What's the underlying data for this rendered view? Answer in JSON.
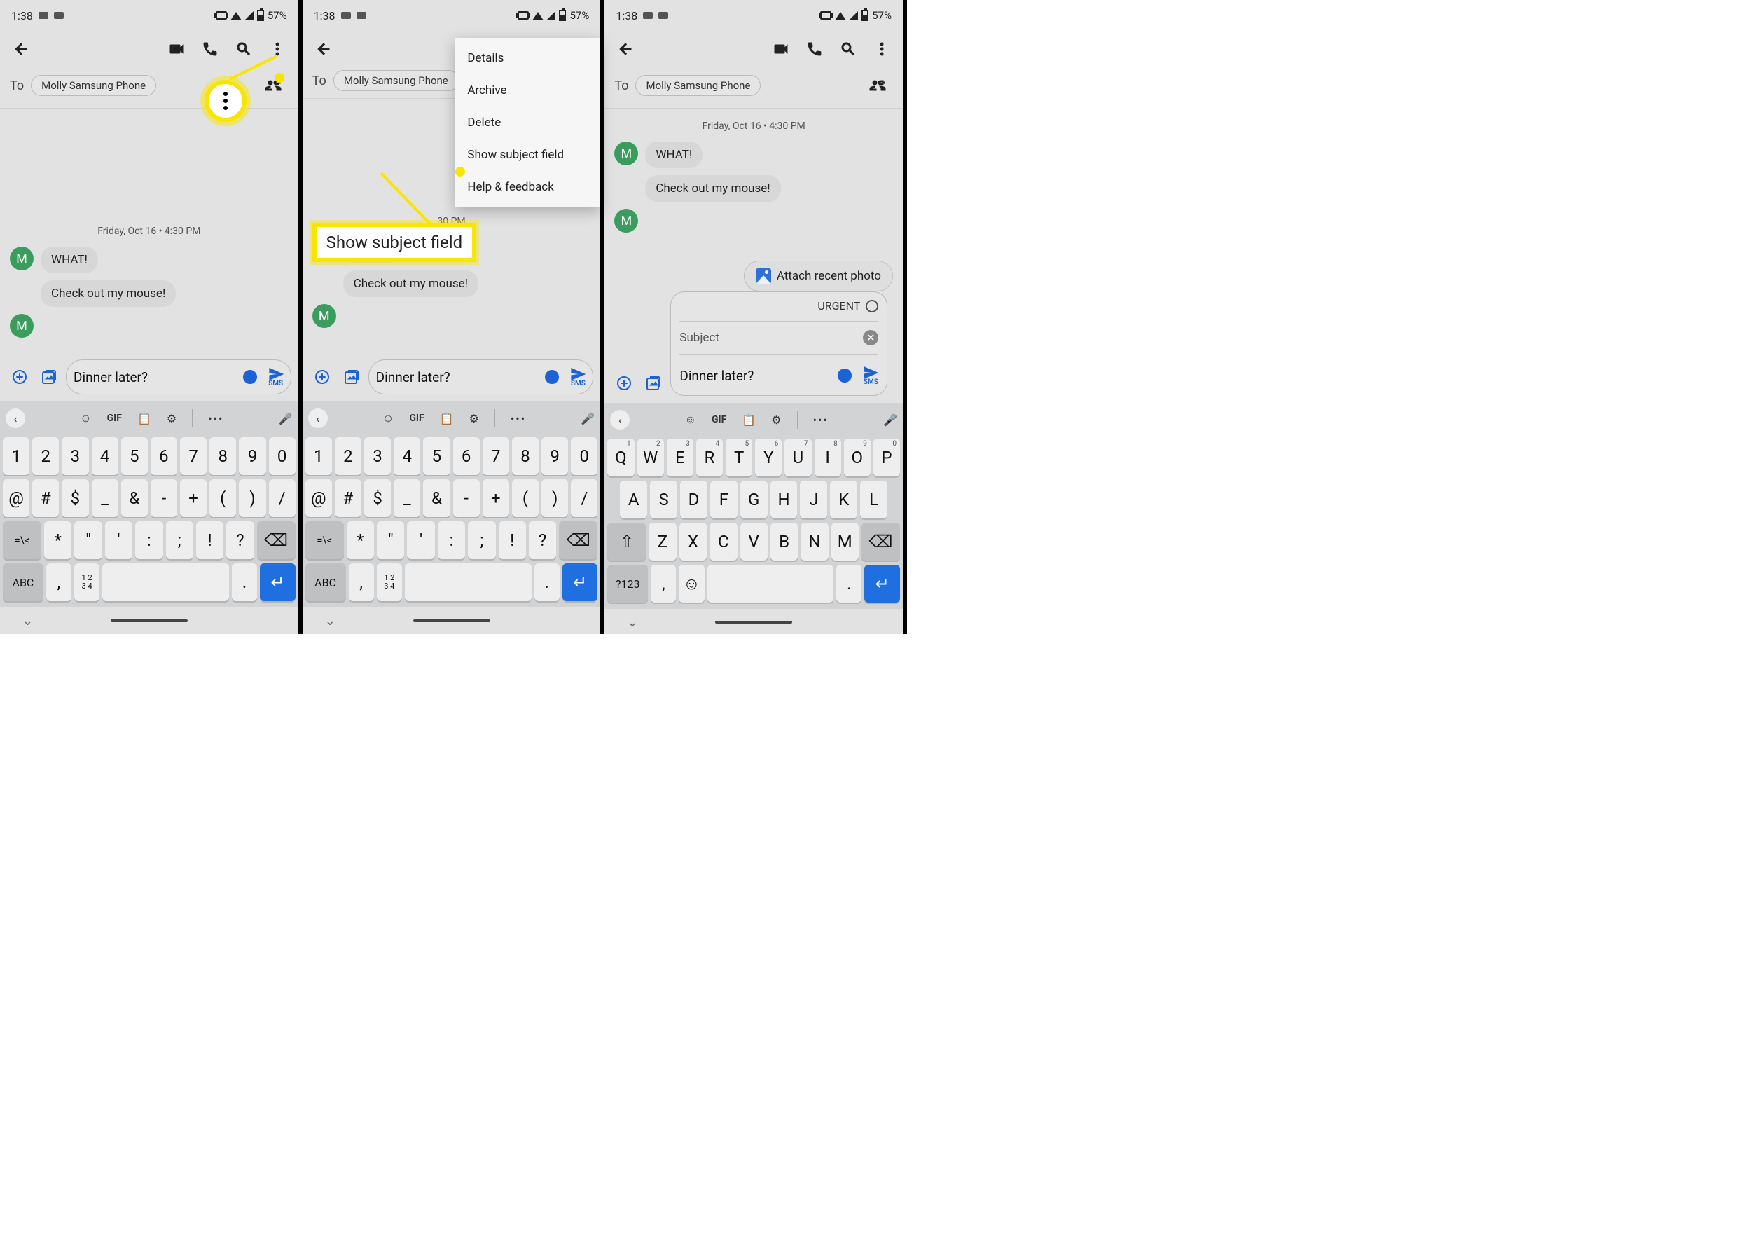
{
  "status": {
    "time": "1:38",
    "battery": "57%"
  },
  "appbar": {
    "back": "back"
  },
  "to": {
    "label": "To",
    "chip": "Molly Samsung Phone"
  },
  "conv": {
    "date": "Friday, Oct 16 • 4:30 PM",
    "avatar_letter": "M",
    "msg1": "WHAT!",
    "msg2": "Check out my mouse!"
  },
  "compose": {
    "text": "Dinner later?",
    "send_mode": "SMS",
    "attach_pill": "Attach recent photo",
    "urgent": "URGENT",
    "subject_placeholder": "Subject"
  },
  "menu": {
    "details": "Details",
    "archive": "Archive",
    "delete": "Delete",
    "show_subject": "Show subject field",
    "help": "Help & feedback"
  },
  "annotation": {
    "label": "Show subject field"
  },
  "kbd_toolbar": {
    "gif": "GIF"
  },
  "kbd": {
    "numrow": [
      "1",
      "2",
      "3",
      "4",
      "5",
      "6",
      "7",
      "8",
      "9",
      "0"
    ],
    "sym1": [
      "@",
      "#",
      "$",
      "_",
      "&",
      "-",
      "+",
      "(",
      ")",
      "/"
    ],
    "sym2": [
      "*",
      "\"",
      "'",
      ":",
      ";",
      "!",
      "?"
    ],
    "sym_shift": "=\\<",
    "abc": "ABC",
    "nums_small": "1 2\n3 4",
    "comma": ",",
    "period": ".",
    "q_row": [
      "Q",
      "W",
      "E",
      "R",
      "T",
      "Y",
      "U",
      "I",
      "O",
      "P"
    ],
    "q_sup": [
      "1",
      "2",
      "3",
      "4",
      "5",
      "6",
      "7",
      "8",
      "9",
      "0"
    ],
    "a_row": [
      "A",
      "S",
      "D",
      "F",
      "G",
      "H",
      "J",
      "K",
      "L"
    ],
    "z_row": [
      "Z",
      "X",
      "C",
      "V",
      "B",
      "N",
      "M"
    ],
    "qmode": "?123",
    "date2": "Friday, Oct 16 • 4:30 PM",
    "partial_time": "30 PM"
  }
}
